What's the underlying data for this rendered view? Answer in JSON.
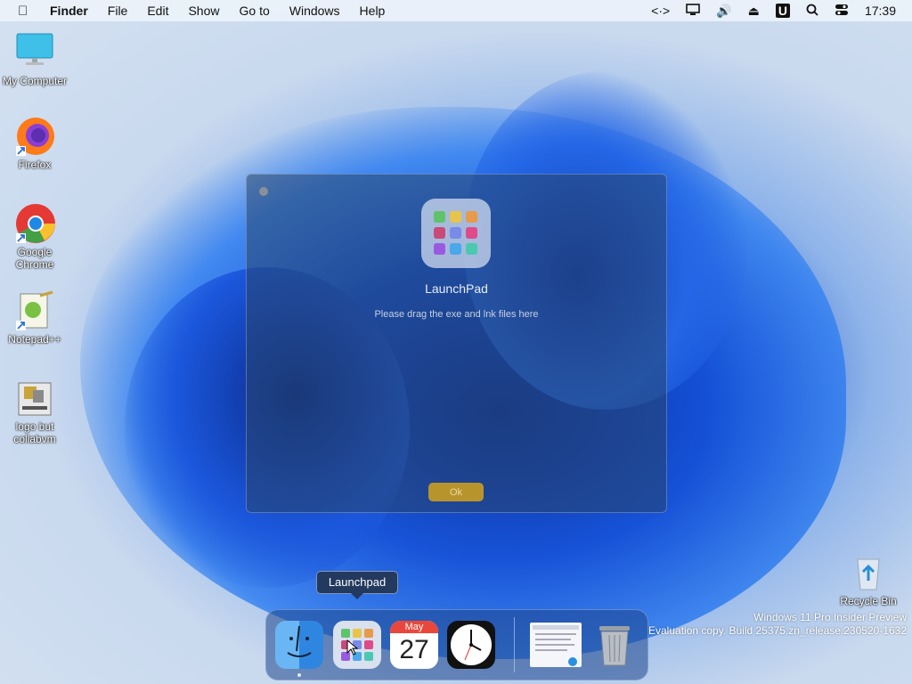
{
  "menubar": {
    "app": "Finder",
    "items": [
      "File",
      "Edit",
      "Show",
      "Go to",
      "Windows",
      "Help"
    ],
    "right_icons": [
      "code-icon",
      "display-icon",
      "volume-icon",
      "eject-icon",
      "u-app-icon",
      "search-icon",
      "control-center-icon"
    ],
    "u_label": "U",
    "clock": "17:39"
  },
  "desktop": {
    "icons": [
      {
        "label": "My Computer",
        "icon": "monitor-icon"
      },
      {
        "label": "Firefox",
        "icon": "firefox-icon"
      },
      {
        "label": "Google Chrome",
        "icon": "chrome-icon"
      },
      {
        "label": "Notepad++",
        "icon": "notepadpp-icon"
      },
      {
        "label": "logo but collabvm",
        "icon": "setup-icon"
      },
      {
        "label": "Recycle Bin",
        "icon": "recycle-bin-icon"
      }
    ]
  },
  "dialog": {
    "title": "LaunchPad",
    "message": "Please drag the exe and lnk files here",
    "ok_label": "Ok"
  },
  "tooltip": {
    "label": "Launchpad"
  },
  "dock": {
    "items": [
      {
        "name": "Finder",
        "icon": "finder-icon"
      },
      {
        "name": "Launchpad",
        "icon": "launchpad-icon"
      },
      {
        "name": "Calendar",
        "icon": "calendar-icon",
        "month": "May",
        "day": "27"
      },
      {
        "name": "Clock",
        "icon": "clock-icon"
      },
      {
        "name": "Window preview",
        "icon": "window-preview-icon"
      },
      {
        "name": "Trash",
        "icon": "trash-icon"
      }
    ]
  },
  "watermark": {
    "line1": "Windows 11 Pro Insider Preview",
    "line2": "Evaluation copy. Build 25375.zn_release.230520-1632"
  },
  "colors": {
    "accent_ok": "#b8942c",
    "menubar_bg": "#ecf2fa",
    "dock_bg": "#1e468c"
  }
}
